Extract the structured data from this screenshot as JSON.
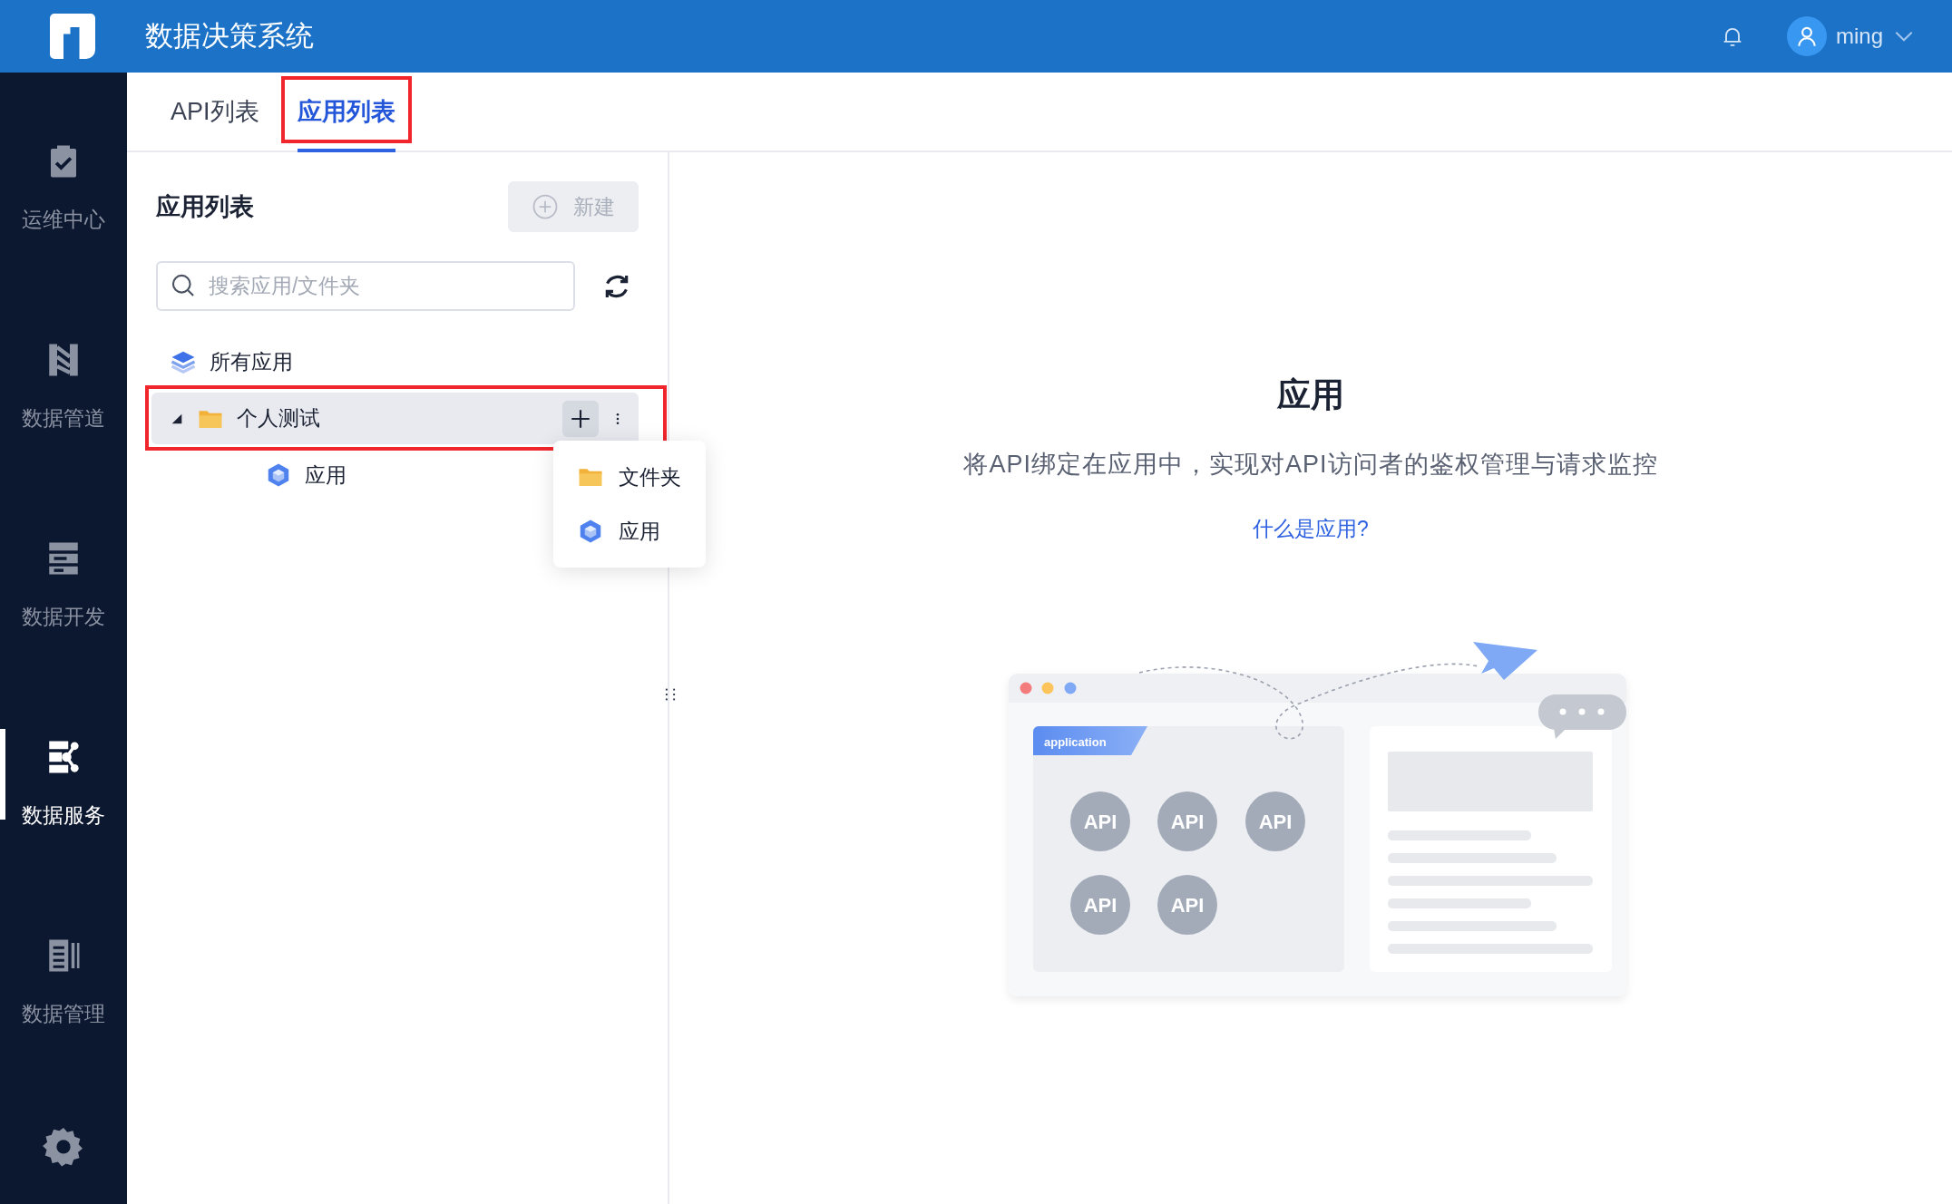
{
  "header": {
    "title": "数据决策系统",
    "user": "ming"
  },
  "sidebar": {
    "items": [
      {
        "label": "运维中心",
        "selected": false
      },
      {
        "label": "数据管道",
        "selected": false
      },
      {
        "label": "数据开发",
        "selected": false
      },
      {
        "label": "数据服务",
        "selected": true
      },
      {
        "label": "数据管理",
        "selected": false
      }
    ]
  },
  "tabs": [
    {
      "label": "API列表",
      "selected": false,
      "highlighted": false
    },
    {
      "label": "应用列表",
      "selected": true,
      "highlighted": true
    }
  ],
  "panel": {
    "title": "应用列表",
    "new_button": {
      "label": "新建",
      "disabled": true
    },
    "search": {
      "placeholder": "搜索应用/文件夹"
    },
    "tree": [
      {
        "label": "所有应用",
        "kind": "all",
        "selected": false,
        "highlighted": false
      },
      {
        "label": "个人测试",
        "kind": "folder",
        "selected": true,
        "highlighted": true,
        "expanded": true,
        "children": [
          {
            "label": "应用",
            "kind": "app",
            "selected": false,
            "highlighted": false
          }
        ]
      }
    ]
  },
  "menu": {
    "items": [
      {
        "label": "文件夹",
        "kind": "folder"
      },
      {
        "label": "应用",
        "kind": "app"
      }
    ]
  },
  "empty_state": {
    "title": "应用",
    "description": "将API绑定在应用中，实现对API访问者的鉴权管理与请求监控",
    "link": "什么是应用?"
  },
  "illustration": {
    "tag": "application",
    "badges": [
      "API",
      "API",
      "API",
      "API",
      "API"
    ]
  }
}
